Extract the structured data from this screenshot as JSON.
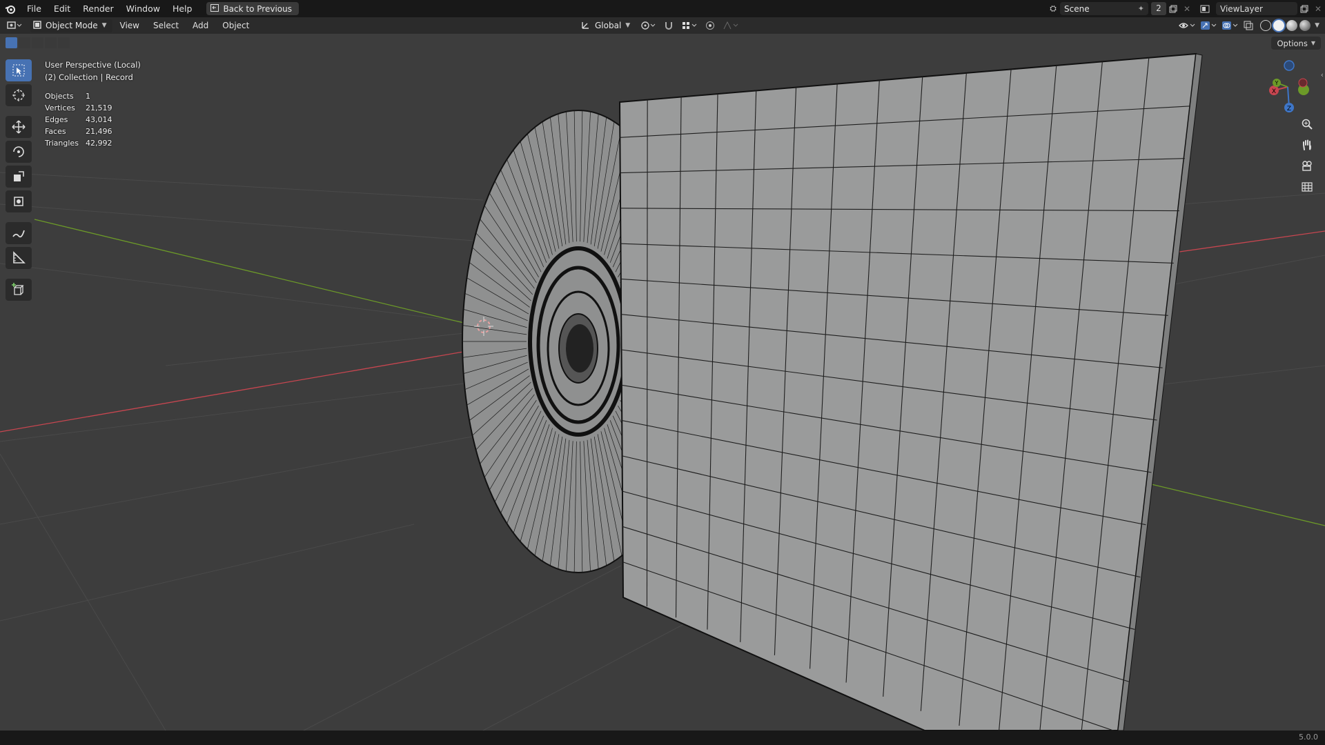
{
  "app": {
    "menu": [
      "File",
      "Edit",
      "Render",
      "Window",
      "Help"
    ],
    "back_button": "Back to Previous",
    "scene_name": "Scene",
    "scene_users": "2",
    "view_layer": "ViewLayer",
    "version": "5.0.0"
  },
  "header": {
    "mode": "Object Mode",
    "menus": [
      "View",
      "Select",
      "Add",
      "Object"
    ],
    "transform_orientation": "Global",
    "options": "Options"
  },
  "viewport": {
    "perspective": "User Perspective (Local)",
    "collection": "(2) Collection | Record",
    "stats": [
      {
        "label": "Objects",
        "value": "1"
      },
      {
        "label": "Vertices",
        "value": "21,519"
      },
      {
        "label": "Edges",
        "value": "43,014"
      },
      {
        "label": "Faces",
        "value": "21,496"
      },
      {
        "label": "Triangles",
        "value": "42,992"
      }
    ],
    "gizmo_axes": {
      "x": "X",
      "y": "Y",
      "z": "Z"
    }
  },
  "colors": {
    "accent": "#4772b3",
    "axis_x": "#c84650",
    "axis_y": "#6c9a28",
    "axis_z": "#3e76c8"
  },
  "icons": {
    "tools": [
      "select-box-icon",
      "cursor-icon",
      "move-icon",
      "rotate-icon",
      "scale-icon",
      "transform-icon",
      "annotate-icon",
      "measure-icon",
      "add-cube-icon"
    ],
    "nav": [
      "zoom-icon",
      "pan-hand-icon",
      "camera-icon",
      "grid-view-icon"
    ]
  }
}
